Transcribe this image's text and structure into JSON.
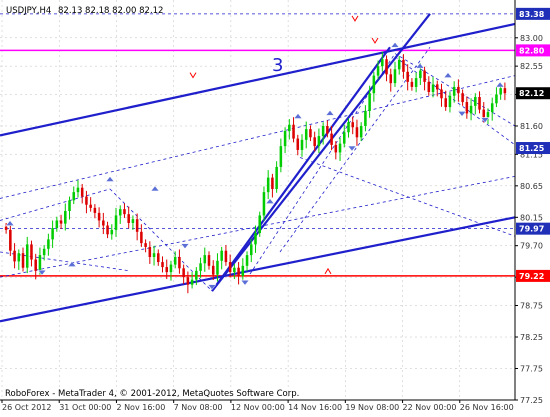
{
  "header": {
    "symbol": "USDJPY,H4",
    "ohlc": "82.13 82.18 82.00 82.12"
  },
  "footer": {
    "copyright": "RoboForex - MetaTrader 4, © 2001-2012, MetaQuotes Software Corp."
  },
  "annotations": {
    "wave_label": "3"
  },
  "colors": {
    "background": "#ffffff",
    "grid": "#c0c0c0",
    "bull_candle": "#00cc00",
    "bear_candle": "#dd0000",
    "trend_lines": "#1f1fcc",
    "resistance_line": "#ff00ff",
    "support_line": "#ff0000",
    "fractal_arrows": "#5b6fd6",
    "axis_text": "#333333",
    "price_badge": "#1f2fb8"
  },
  "chart_data": {
    "type": "candlestick",
    "title": "USDJPY,H4",
    "ylim": [
      77.25,
      83.6
    ],
    "grid": true,
    "y_ticks": [
      "83.00",
      "82.55",
      "82.10",
      "81.60",
      "81.15",
      "80.65",
      "80.15",
      "79.70",
      "79.20",
      "78.75",
      "78.25",
      "77.75",
      "77.25"
    ],
    "x_ticks": [
      "26 Oct 2012",
      "31 Oct 00:00",
      "2 Nov 16:00",
      "7 Nov 08:00",
      "12 Nov 00:00",
      "14 Nov 16:00",
      "19 Nov 08:00",
      "22 Nov 00:00",
      "26 Nov 16:00"
    ],
    "price_labels": [
      {
        "value": "83.38"
      },
      {
        "value": "82.80"
      },
      {
        "value": "82.12"
      },
      {
        "value": "81.25"
      },
      {
        "value": "79.97"
      },
      {
        "value": "79.22"
      }
    ],
    "horizontal_lines": {
      "resistance": 82.8,
      "support": 79.22,
      "target": 79.97
    },
    "closes": [
      79.95,
      79.62,
      79.45,
      79.58,
      79.35,
      79.72,
      79.48,
      79.3,
      79.55,
      79.65,
      79.8,
      79.98,
      80.1,
      80.05,
      80.25,
      80.42,
      80.55,
      80.62,
      80.48,
      80.35,
      80.3,
      80.22,
      80.1,
      80.02,
      79.88,
      79.95,
      80.18,
      80.28,
      80.2,
      80.06,
      80.12,
      79.92,
      79.74,
      79.68,
      79.52,
      79.58,
      79.44,
      79.36,
      79.28,
      79.4,
      79.52,
      79.34,
      79.2,
      79.08,
      79.16,
      79.3,
      79.42,
      79.55,
      79.38,
      79.24,
      79.46,
      79.62,
      79.44,
      79.28,
      79.35,
      79.22,
      79.38,
      79.55,
      79.72,
      79.9,
      80.18,
      80.55,
      80.78,
      80.6,
      80.95,
      81.28,
      81.52,
      81.62,
      81.4,
      81.22,
      81.38,
      81.55,
      81.42,
      81.28,
      81.44,
      81.6,
      81.48,
      81.3,
      81.18,
      81.32,
      81.5,
      81.66,
      81.58,
      81.42,
      81.6,
      81.84,
      82.12,
      82.4,
      82.55,
      82.66,
      82.42,
      82.28,
      82.5,
      82.65,
      82.46,
      82.3,
      82.22,
      82.36,
      82.48,
      82.3,
      82.14,
      82.26,
      82.18,
      82.04,
      81.9,
      82.08,
      82.22,
      82.12,
      81.98,
      81.8,
      81.92,
      82.06,
      81.86,
      81.74,
      81.82,
      81.96,
      82.1,
      82.2,
      82.12
    ],
    "series": [
      {
        "values_from": "closes"
      }
    ]
  }
}
